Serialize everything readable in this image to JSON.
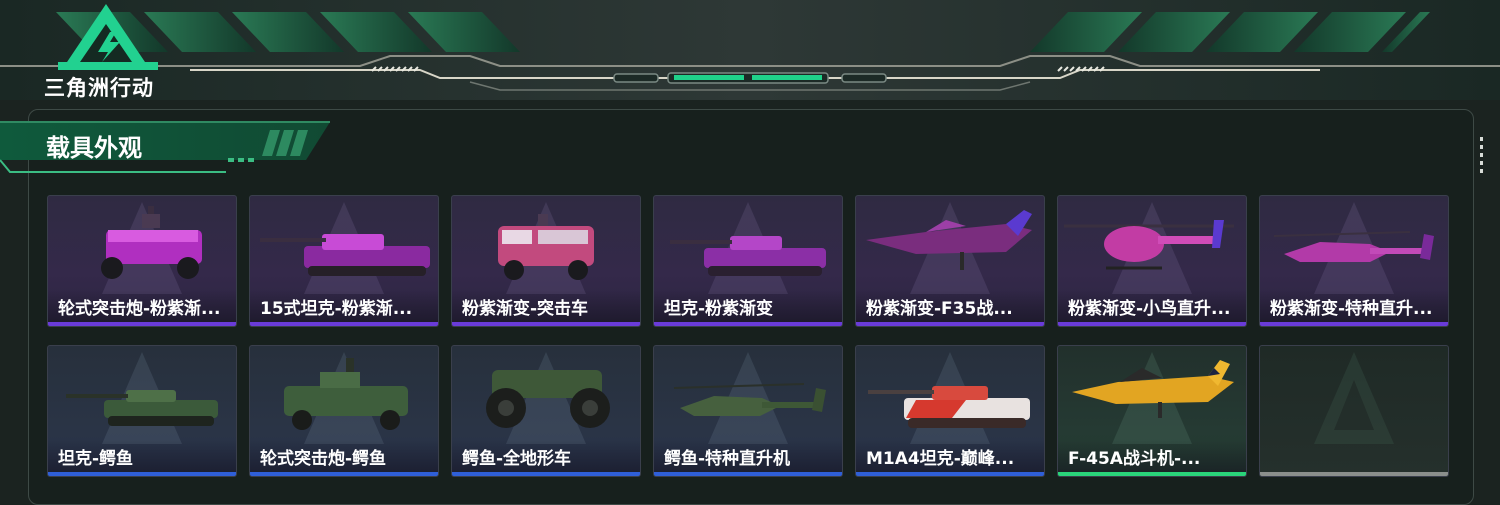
{
  "brand": {
    "logo_text": "三角洲行动"
  },
  "section": {
    "title": "载具外观"
  },
  "colors": {
    "purple_bar": "#6a3bd9",
    "blue_bar": "#2f5fd8",
    "green_bar": "#2ad47a",
    "gray_bar": "#8b8f8c",
    "accent": "#1fd28a"
  },
  "items": [
    {
      "name": "轮式突击炮-粉紫渐...",
      "rarity": "purple",
      "icon": "wheeled-assault-gun-icon"
    },
    {
      "name": "15式坦克-粉紫渐...",
      "rarity": "purple",
      "icon": "light-tank-icon"
    },
    {
      "name": "粉紫渐变-突击车",
      "rarity": "purple",
      "icon": "assault-vehicle-icon"
    },
    {
      "name": "坦克-粉紫渐变",
      "rarity": "purple",
      "icon": "tank-icon"
    },
    {
      "name": "粉紫渐变-F35战...",
      "rarity": "purple",
      "icon": "fighter-jet-icon"
    },
    {
      "name": "粉紫渐变-小鸟直升...",
      "rarity": "purple",
      "icon": "little-bird-helicopter-icon"
    },
    {
      "name": "粉紫渐变-特种直升...",
      "rarity": "purple",
      "icon": "attack-helicopter-icon"
    },
    {
      "name": "坦克-鳄鱼",
      "rarity": "blue",
      "icon": "tank-icon"
    },
    {
      "name": "轮式突击炮-鳄鱼",
      "rarity": "blue",
      "icon": "wheeled-assault-gun-icon"
    },
    {
      "name": "鳄鱼-全地形车",
      "rarity": "blue",
      "icon": "atv-icon"
    },
    {
      "name": "鳄鱼-特种直升机",
      "rarity": "blue",
      "icon": "attack-helicopter-icon"
    },
    {
      "name": "M1A4坦克-巅峰...",
      "rarity": "blue",
      "icon": "tank-icon"
    },
    {
      "name": "F-45A战斗机-...",
      "rarity": "green",
      "icon": "fighter-jet-icon"
    },
    {
      "name": "",
      "rarity": "gray",
      "icon": "empty-slot-icon"
    }
  ]
}
